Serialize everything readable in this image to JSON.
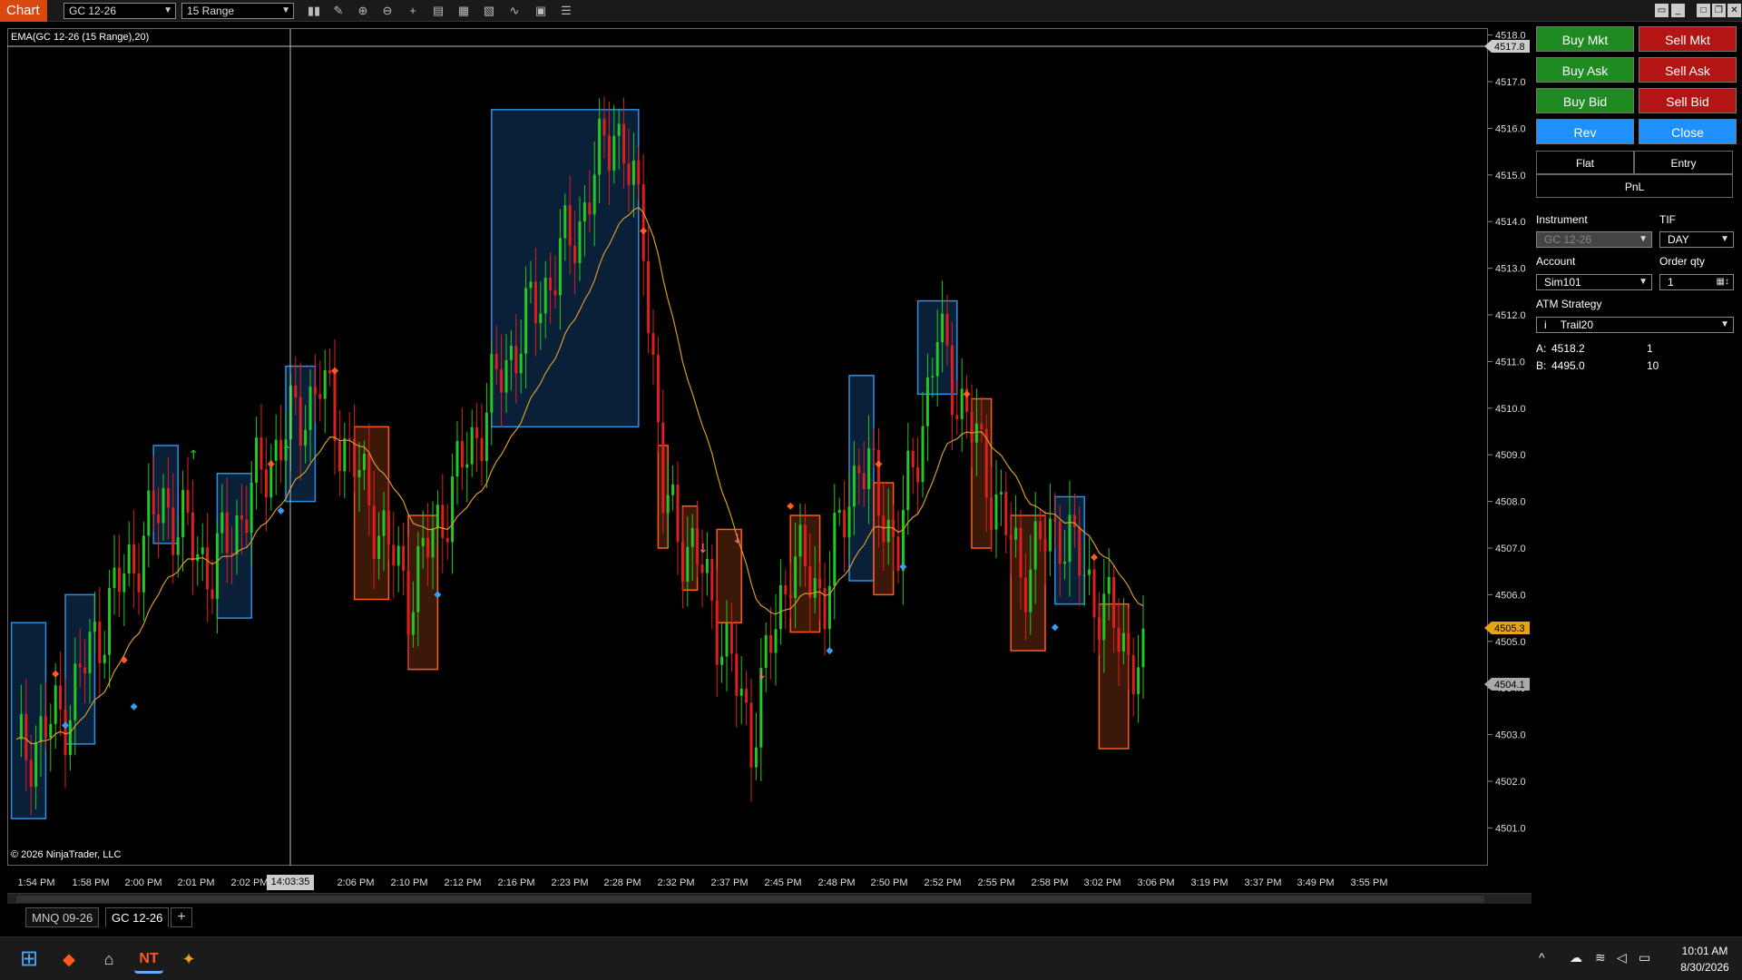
{
  "toolbar": {
    "chart_tab": "Chart",
    "instrument_value": "GC 12-26",
    "interval_value": "15 Range",
    "icons": [
      "bar-type-icon",
      "draw-icon",
      "zoom-in-icon",
      "zoom-out-icon",
      "crosshair-icon",
      "data-box-icon",
      "properties-icon",
      "template-icon",
      "strategies-icon",
      "indicators-icon",
      "more-icon"
    ]
  },
  "chart": {
    "indicator_label": "EMA(GC 12-26 (15 Range),20)",
    "copyright": "© 2026 NinjaTrader, LLC",
    "crosshair_time": "14:03:35",
    "price_tag_top": "4517.8",
    "price_tag_current": "4505.3",
    "price_tag_bottom": "4504.1",
    "price_ticks": [
      "4518.0",
      "4517.0",
      "4516.0",
      "4515.0",
      "4514.0",
      "4513.0",
      "4512.0",
      "4511.0",
      "4510.0",
      "4509.0",
      "4508.0",
      "4507.0",
      "4506.0",
      "4505.0",
      "4504.0",
      "4503.0",
      "4502.0",
      "4501.0"
    ],
    "time_ticks": [
      "1:54 PM",
      "1:58 PM",
      "2:00 PM",
      "2:01 PM",
      "2:02 PM",
      "2:06 PM",
      "2:10 PM",
      "2:12 PM",
      "2:16 PM",
      "2:23 PM",
      "2:28 PM",
      "2:32 PM",
      "2:37 PM",
      "2:45 PM",
      "2:48 PM",
      "2:50 PM",
      "2:52 PM",
      "2:55 PM",
      "2:58 PM",
      "3:02 PM",
      "3:06 PM",
      "3:19 PM",
      "3:37 PM",
      "3:49 PM",
      "3:55 PM"
    ],
    "colors": {
      "up": "#22c922",
      "down": "#e01e1e",
      "ema": "#d89a2a",
      "box_blue": "#2f8fe0",
      "box_orange": "#ff5a1f",
      "current_tag": "#e8a317"
    }
  },
  "chart_tabs": {
    "tabs": [
      "MNQ 09-26",
      "GC 12-26"
    ],
    "active": "GC 12-26",
    "add": "+"
  },
  "chart_trader": {
    "buy_mkt": "Buy Mkt",
    "sell_mkt": "Sell Mkt",
    "buy_ask": "Buy Ask",
    "sell_ask": "Sell Ask",
    "buy_bid": "Buy Bid",
    "sell_bid": "Sell Bid",
    "rev": "Rev",
    "close": "Close",
    "flat": "Flat",
    "entry": "Entry",
    "pnl": "PnL",
    "instrument_label": "Instrument",
    "instrument_value": "GC 12-26",
    "tif_label": "TIF",
    "tif_value": "DAY",
    "account_label": "Account",
    "account_value": "Sim101",
    "qty_label": "Order qty",
    "qty_value": "1",
    "atm_label": "ATM Strategy",
    "atm_value": "Trail20",
    "ask_label": "A:",
    "ask_price": "4518.2",
    "ask_size": "1",
    "bid_label": "B:",
    "bid_price": "4495.0",
    "bid_size": "10"
  },
  "taskbar": {
    "time": "10:01 AM",
    "date": "8/30/2026"
  }
}
